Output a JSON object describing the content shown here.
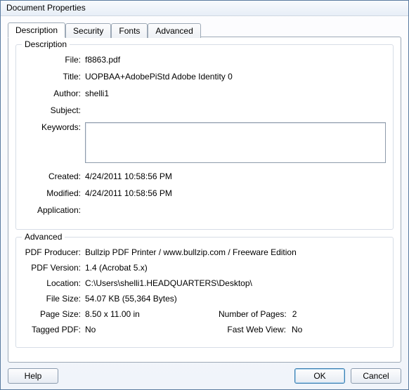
{
  "window": {
    "title": "Document Properties"
  },
  "tabs": {
    "description": "Description",
    "security": "Security",
    "fonts": "Fonts",
    "advanced": "Advanced"
  },
  "description_group": {
    "title": "Description",
    "labels": {
      "file": "File:",
      "title": "Title:",
      "author": "Author:",
      "subject": "Subject:",
      "keywords": "Keywords:",
      "created": "Created:",
      "modified": "Modified:",
      "application": "Application:"
    },
    "values": {
      "file": "f8863.pdf",
      "title": "UOPBAA+AdobePiStd Adobe Identity 0",
      "author": "shelli1",
      "subject": "",
      "keywords": "",
      "created": "4/24/2011 10:58:56 PM",
      "modified": "4/24/2011 10:58:56 PM",
      "application": ""
    }
  },
  "advanced_group": {
    "title": "Advanced",
    "labels": {
      "producer": "PDF Producer:",
      "version": "PDF Version:",
      "location": "Location:",
      "filesize": "File Size:",
      "pagesize": "Page Size:",
      "numpages": "Number of Pages:",
      "tagged": "Tagged PDF:",
      "fastweb": "Fast Web View:"
    },
    "values": {
      "producer": "Bullzip PDF Printer / www.bullzip.com / Freeware Edition",
      "version": "1.4 (Acrobat 5.x)",
      "location": "C:\\Users\\shelli1.HEADQUARTERS\\Desktop\\",
      "filesize": "54.07 KB (55,364 Bytes)",
      "pagesize": "8.50 x 11.00 in",
      "numpages": "2",
      "tagged": "No",
      "fastweb": "No"
    }
  },
  "buttons": {
    "help": "Help",
    "ok": "OK",
    "cancel": "Cancel"
  }
}
